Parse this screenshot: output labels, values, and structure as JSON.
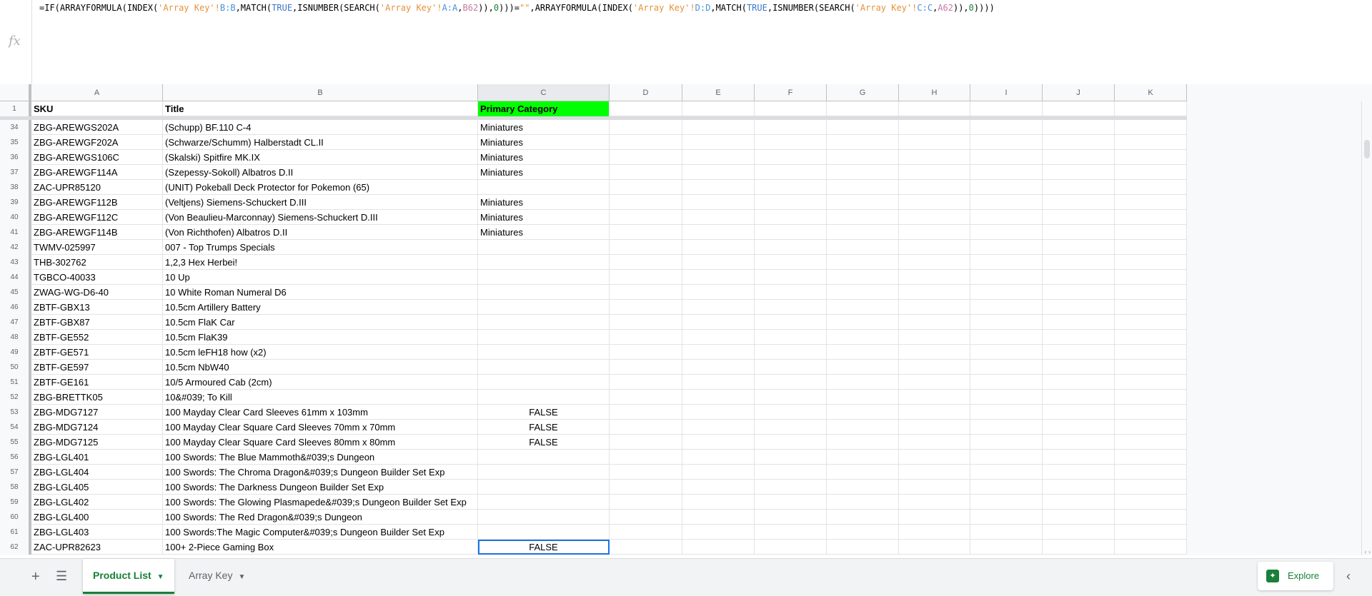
{
  "formula_bar": {
    "fx_label": "fx",
    "formula": "=IF(ARRAYFORMULA(INDEX('Array Key'!B:B,MATCH(TRUE,ISNUMBER(SEARCH('Array Key'!A:A,B62)),0)))=\"\",ARRAYFORMULA(INDEX('Array Key'!D:D,MATCH(TRUE,ISNUMBER(SEARCH('Array Key'!C:C,A62)),0))))"
  },
  "columns": [
    "A",
    "B",
    "C",
    "D",
    "E",
    "F",
    "G",
    "H",
    "I",
    "J",
    "K"
  ],
  "header_row": {
    "num": "1",
    "sku": "SKU",
    "title": "Title",
    "category": "Primary Category"
  },
  "rows": [
    {
      "num": "34",
      "sku": "ZBG-AREWGS202A",
      "title": "(Schupp) BF.110 C-4",
      "cat": "Miniatures"
    },
    {
      "num": "35",
      "sku": "ZBG-AREWGF202A",
      "title": "(Schwarze/Schumm) Halberstadt CL.II",
      "cat": "Miniatures"
    },
    {
      "num": "36",
      "sku": "ZBG-AREWGS106C",
      "title": "(Skalski) Spitfire MK.IX",
      "cat": "Miniatures"
    },
    {
      "num": "37",
      "sku": "ZBG-AREWGF114A",
      "title": "(Szepessy-Sokoll) Albatros D.II",
      "cat": "Miniatures"
    },
    {
      "num": "38",
      "sku": "ZAC-UPR85120",
      "title": "(UNIT) Pokeball Deck Protector for Pokemon (65)",
      "cat": ""
    },
    {
      "num": "39",
      "sku": "ZBG-AREWGF112B",
      "title": "(Veltjens) Siemens-Schuckert D.III",
      "cat": "Miniatures"
    },
    {
      "num": "40",
      "sku": "ZBG-AREWGF112C",
      "title": "(Von Beaulieu-Marconnay) Siemens-Schuckert D.III",
      "cat": "Miniatures"
    },
    {
      "num": "41",
      "sku": "ZBG-AREWGF114B",
      "title": "(Von Richthofen) Albatros D.II",
      "cat": "Miniatures"
    },
    {
      "num": "42",
      "sku": "TWMV-025997",
      "title": "007 - Top Trumps Specials",
      "cat": ""
    },
    {
      "num": "43",
      "sku": "THB-302762",
      "title": "1,2,3 Hex Herbei!",
      "cat": ""
    },
    {
      "num": "44",
      "sku": "TGBCO-40033",
      "title": "10 Up",
      "cat": ""
    },
    {
      "num": "45",
      "sku": "ZWAG-WG-D6-40",
      "title": "10 White Roman Numeral D6",
      "cat": ""
    },
    {
      "num": "46",
      "sku": "ZBTF-GBX13",
      "title": "10.5cm Artillery Battery",
      "cat": ""
    },
    {
      "num": "47",
      "sku": "ZBTF-GBX87",
      "title": "10.5cm FlaK Car",
      "cat": ""
    },
    {
      "num": "48",
      "sku": "ZBTF-GE552",
      "title": "10.5cm FlaK39",
      "cat": ""
    },
    {
      "num": "49",
      "sku": "ZBTF-GE571",
      "title": "10.5cm leFH18 how (x2)",
      "cat": ""
    },
    {
      "num": "50",
      "sku": "ZBTF-GE597",
      "title": "10.5cm NbW40",
      "cat": ""
    },
    {
      "num": "51",
      "sku": "ZBTF-GE161",
      "title": "10/5 Armoured Cab (2cm)",
      "cat": ""
    },
    {
      "num": "52",
      "sku": "ZBG-BRETTK05",
      "title": "10&#039; To Kill",
      "cat": ""
    },
    {
      "num": "53",
      "sku": "ZBG-MDG7127",
      "title": "100 Mayday Clear Card Sleeves 61mm x 103mm",
      "cat": "FALSE"
    },
    {
      "num": "54",
      "sku": "ZBG-MDG7124",
      "title": "100 Mayday Clear Square Card Sleeves 70mm x 70mm",
      "cat": "FALSE"
    },
    {
      "num": "55",
      "sku": "ZBG-MDG7125",
      "title": "100 Mayday Clear Square Card Sleeves 80mm x 80mm",
      "cat": "FALSE"
    },
    {
      "num": "56",
      "sku": "ZBG-LGL401",
      "title": "100 Swords: The Blue Mammoth&#039;s Dungeon",
      "cat": ""
    },
    {
      "num": "57",
      "sku": "ZBG-LGL404",
      "title": "100 Swords: The Chroma Dragon&#039;s Dungeon Builder Set Exp",
      "cat": ""
    },
    {
      "num": "58",
      "sku": "ZBG-LGL405",
      "title": "100 Swords: The Darkness Dungeon Builder Set Exp",
      "cat": ""
    },
    {
      "num": "59",
      "sku": "ZBG-LGL402",
      "title": "100 Swords: The Glowing Plasmapede&#039;s Dungeon Builder Set Exp",
      "cat": ""
    },
    {
      "num": "60",
      "sku": "ZBG-LGL400",
      "title": "100 Swords: The Red Dragon&#039;s Dungeon",
      "cat": ""
    },
    {
      "num": "61",
      "sku": "ZBG-LGL403",
      "title": "100 Swords:The Magic Computer&#039;s Dungeon Builder Set Exp",
      "cat": ""
    },
    {
      "num": "62",
      "sku": "ZAC-UPR82623",
      "title": "100+ 2-Piece Gaming Box",
      "cat": "FALSE"
    }
  ],
  "sheet_tabs": [
    {
      "label": "Product List",
      "active": true
    },
    {
      "label": "Array Key",
      "active": false
    }
  ],
  "explore_label": "Explore",
  "colors": {
    "header_fill": "#00ff00",
    "active_tab": "#188038",
    "selection": "#1a73e8"
  }
}
